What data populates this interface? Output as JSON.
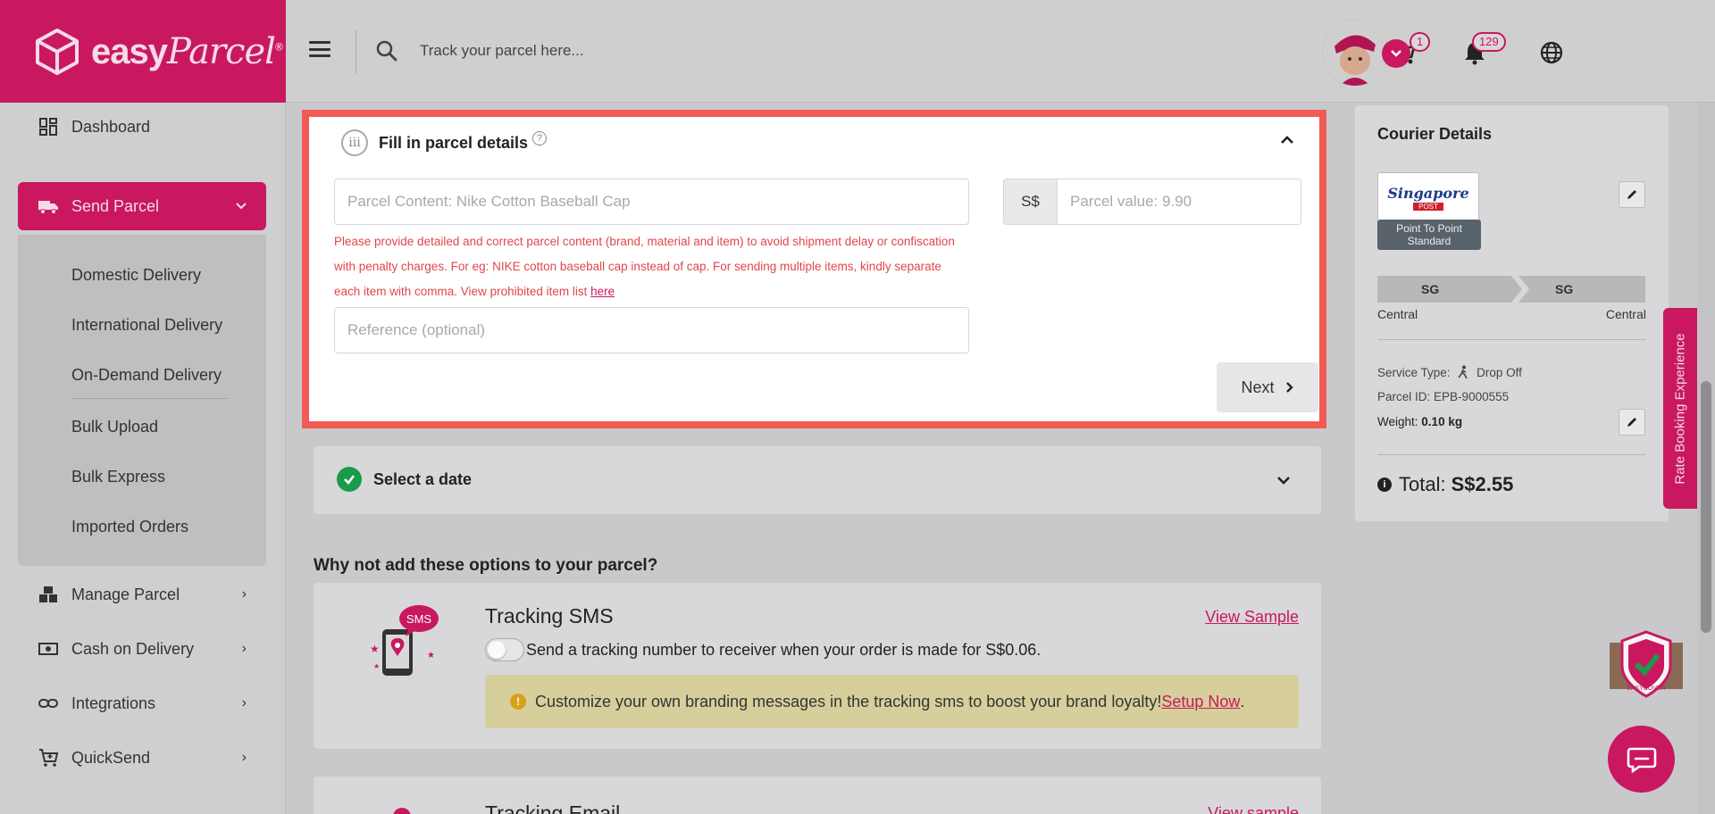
{
  "brand": {
    "name_bold": "easy",
    "name_script": "Parcel",
    "mark": "®"
  },
  "topbar": {
    "search_placeholder": "Track your parcel here...",
    "cart_count": "1",
    "notification_count": "129"
  },
  "sidebar": {
    "items": [
      {
        "label": "Dashboard",
        "icon": "dashboard-icon"
      },
      {
        "label": "Send Parcel",
        "icon": "truck-icon",
        "active": true
      },
      {
        "label": "Manage Parcel",
        "icon": "boxes-icon"
      },
      {
        "label": "Cash on Delivery",
        "icon": "cash-icon"
      },
      {
        "label": "Integrations",
        "icon": "link-icon"
      },
      {
        "label": "QuickSend",
        "icon": "cart-icon"
      }
    ],
    "sub_items": [
      "Domestic Delivery",
      "International Delivery",
      "On-Demand Delivery",
      "Bulk Upload",
      "Bulk Express",
      "Imported Orders"
    ]
  },
  "parcel_details": {
    "step": "iii",
    "title": "Fill in parcel details",
    "content_placeholder": "Parcel Content: Nike Cotton Baseball Cap",
    "currency": "S$",
    "value_placeholder": "Parcel value: 9.90",
    "warning_text": "Please provide detailed and correct parcel content (brand, material and item) to avoid shipment delay or confiscation with penalty charges. For eg: NIKE cotton baseball cap instead of cap. For sending multiple items, kindly separate each item with comma. View prohibited item list ",
    "warning_link": "here",
    "reference_placeholder": "Reference (optional)",
    "next_label": "Next"
  },
  "select_date": {
    "title": "Select a date"
  },
  "options": {
    "heading": "Why not add these options to your parcel?",
    "sms": {
      "title": "Tracking SMS",
      "view_sample": "View Sample",
      "description": "Send a tracking number to receiver when your order is made for S$0.06.",
      "promo_text": "Customize your own branding messages in the tracking sms to boost your brand loyalty! ",
      "promo_link": "Setup Now",
      "promo_end": ".",
      "icon_badge": "SMS"
    },
    "email": {
      "title": "Tracking Email",
      "view_sample": "View sample"
    }
  },
  "courier": {
    "title": "Courier Details",
    "logo_text": "Singapore",
    "logo_sub": "POST",
    "service_tag": "Point To Point Standard",
    "from_code": "SG",
    "to_code": "SG",
    "from_region": "Central",
    "to_region": "Central",
    "service_type_label": "Service Type:",
    "service_type_value": "Drop Off",
    "parcel_id_label": "Parcel ID:",
    "parcel_id_value": "EPB-9000555",
    "weight_label": "Weight:",
    "weight_value": "0.10 kg",
    "total_label": "Total:",
    "total_value": "S$2.55"
  },
  "floating": {
    "rate_tab": "Rate Booking Experience",
    "easycover": "EASYCOVER"
  },
  "colors": {
    "brand": "#c9185f",
    "highlight": "#f25a56",
    "success": "#1b9a4a",
    "warning_text": "#e1464a"
  }
}
